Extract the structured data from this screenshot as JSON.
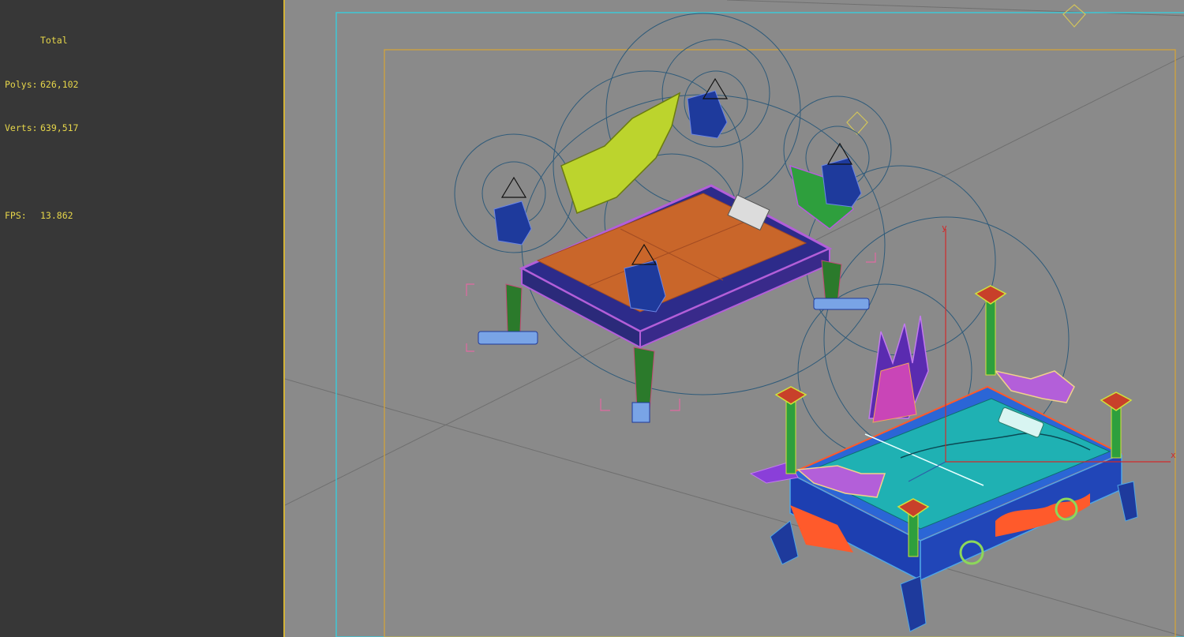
{
  "stats": {
    "header": "Total",
    "polys_label": "Polys:",
    "polys_value": "626,102",
    "verts_label": "Verts:",
    "verts_value": "639,517",
    "fps_label": "FPS:",
    "fps_value": "13.862"
  },
  "viewport": {
    "axis_x_label": "x",
    "axis_y_label": "y",
    "colors": {
      "background": "#8a8a8a",
      "safe_frame_outer": "#3ec7d6",
      "safe_frame_inner": "#d7a636",
      "gizmo_x": "#d12a2a",
      "gizmo_y": "#d12a2a",
      "helper_circles": "#2f5b7a"
    },
    "objects": [
      {
        "name": "pool-table-orange",
        "felt_color": "#c9662a",
        "frame_color": "#b35fd9"
      },
      {
        "name": "pool-table-teal",
        "felt_color": "#1fb1b3",
        "frame_color": "#2b66d6"
      }
    ]
  }
}
